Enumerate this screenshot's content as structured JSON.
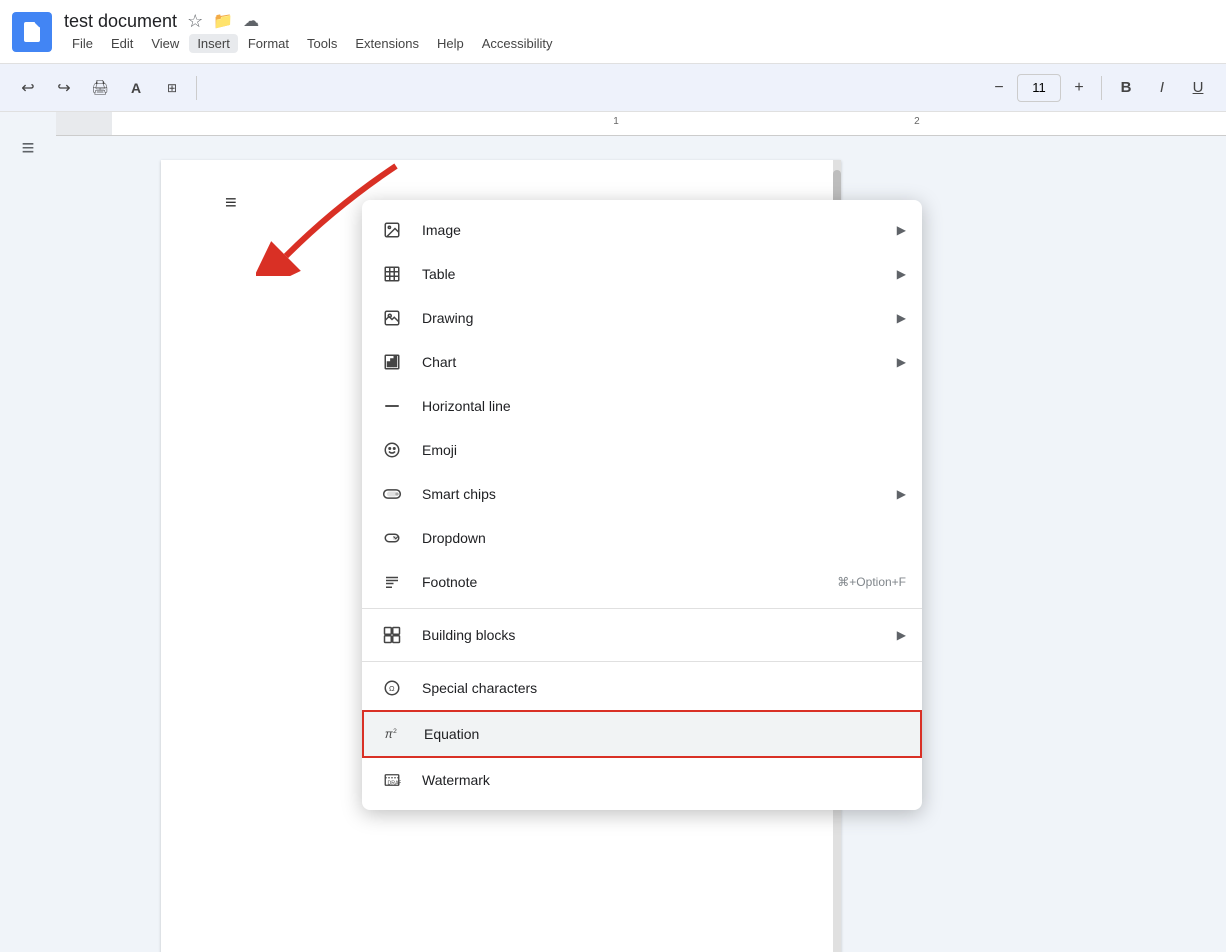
{
  "app": {
    "title": "test document",
    "icon_label": "docs-icon"
  },
  "title_icons": {
    "star": "☆",
    "folder": "⊞",
    "cloud": "☁"
  },
  "menubar": {
    "items": [
      "File",
      "Edit",
      "View",
      "Insert",
      "Format",
      "Tools",
      "Extensions",
      "Help",
      "Accessibility"
    ]
  },
  "toolbar": {
    "undo": "↩",
    "redo": "↪",
    "print": "🖨",
    "paint_format": "A",
    "zoom": "⊞",
    "font_size": "11",
    "minus": "−",
    "plus": "+"
  },
  "insert_menu": {
    "items": [
      {
        "id": "image",
        "label": "Image",
        "has_arrow": true,
        "icon": "image"
      },
      {
        "id": "table",
        "label": "Table",
        "has_arrow": true,
        "icon": "table"
      },
      {
        "id": "drawing",
        "label": "Drawing",
        "has_arrow": true,
        "icon": "drawing"
      },
      {
        "id": "chart",
        "label": "Chart",
        "has_arrow": true,
        "icon": "chart"
      },
      {
        "id": "horizontal_line",
        "label": "Horizontal line",
        "has_arrow": false,
        "icon": "hline",
        "divider_before": false
      },
      {
        "id": "emoji",
        "label": "Emoji",
        "has_arrow": false,
        "icon": "emoji"
      },
      {
        "id": "smart_chips",
        "label": "Smart chips",
        "has_arrow": true,
        "icon": "smart_chips"
      },
      {
        "id": "dropdown",
        "label": "Dropdown",
        "has_arrow": false,
        "icon": "dropdown"
      },
      {
        "id": "footnote",
        "label": "Footnote",
        "has_arrow": false,
        "icon": "footnote",
        "shortcut": "⌘+Option+F"
      },
      {
        "id": "building_blocks",
        "label": "Building blocks",
        "has_arrow": true,
        "icon": "building_blocks",
        "divider_before": true
      },
      {
        "id": "special_characters",
        "label": "Special characters",
        "has_arrow": false,
        "icon": "special_chars",
        "divider_before": true
      },
      {
        "id": "equation",
        "label": "Equation",
        "has_arrow": false,
        "icon": "equation",
        "highlighted": true
      },
      {
        "id": "watermark",
        "label": "Watermark",
        "has_arrow": false,
        "icon": "watermark"
      }
    ]
  },
  "sidebar": {
    "list_icon": "≡"
  }
}
